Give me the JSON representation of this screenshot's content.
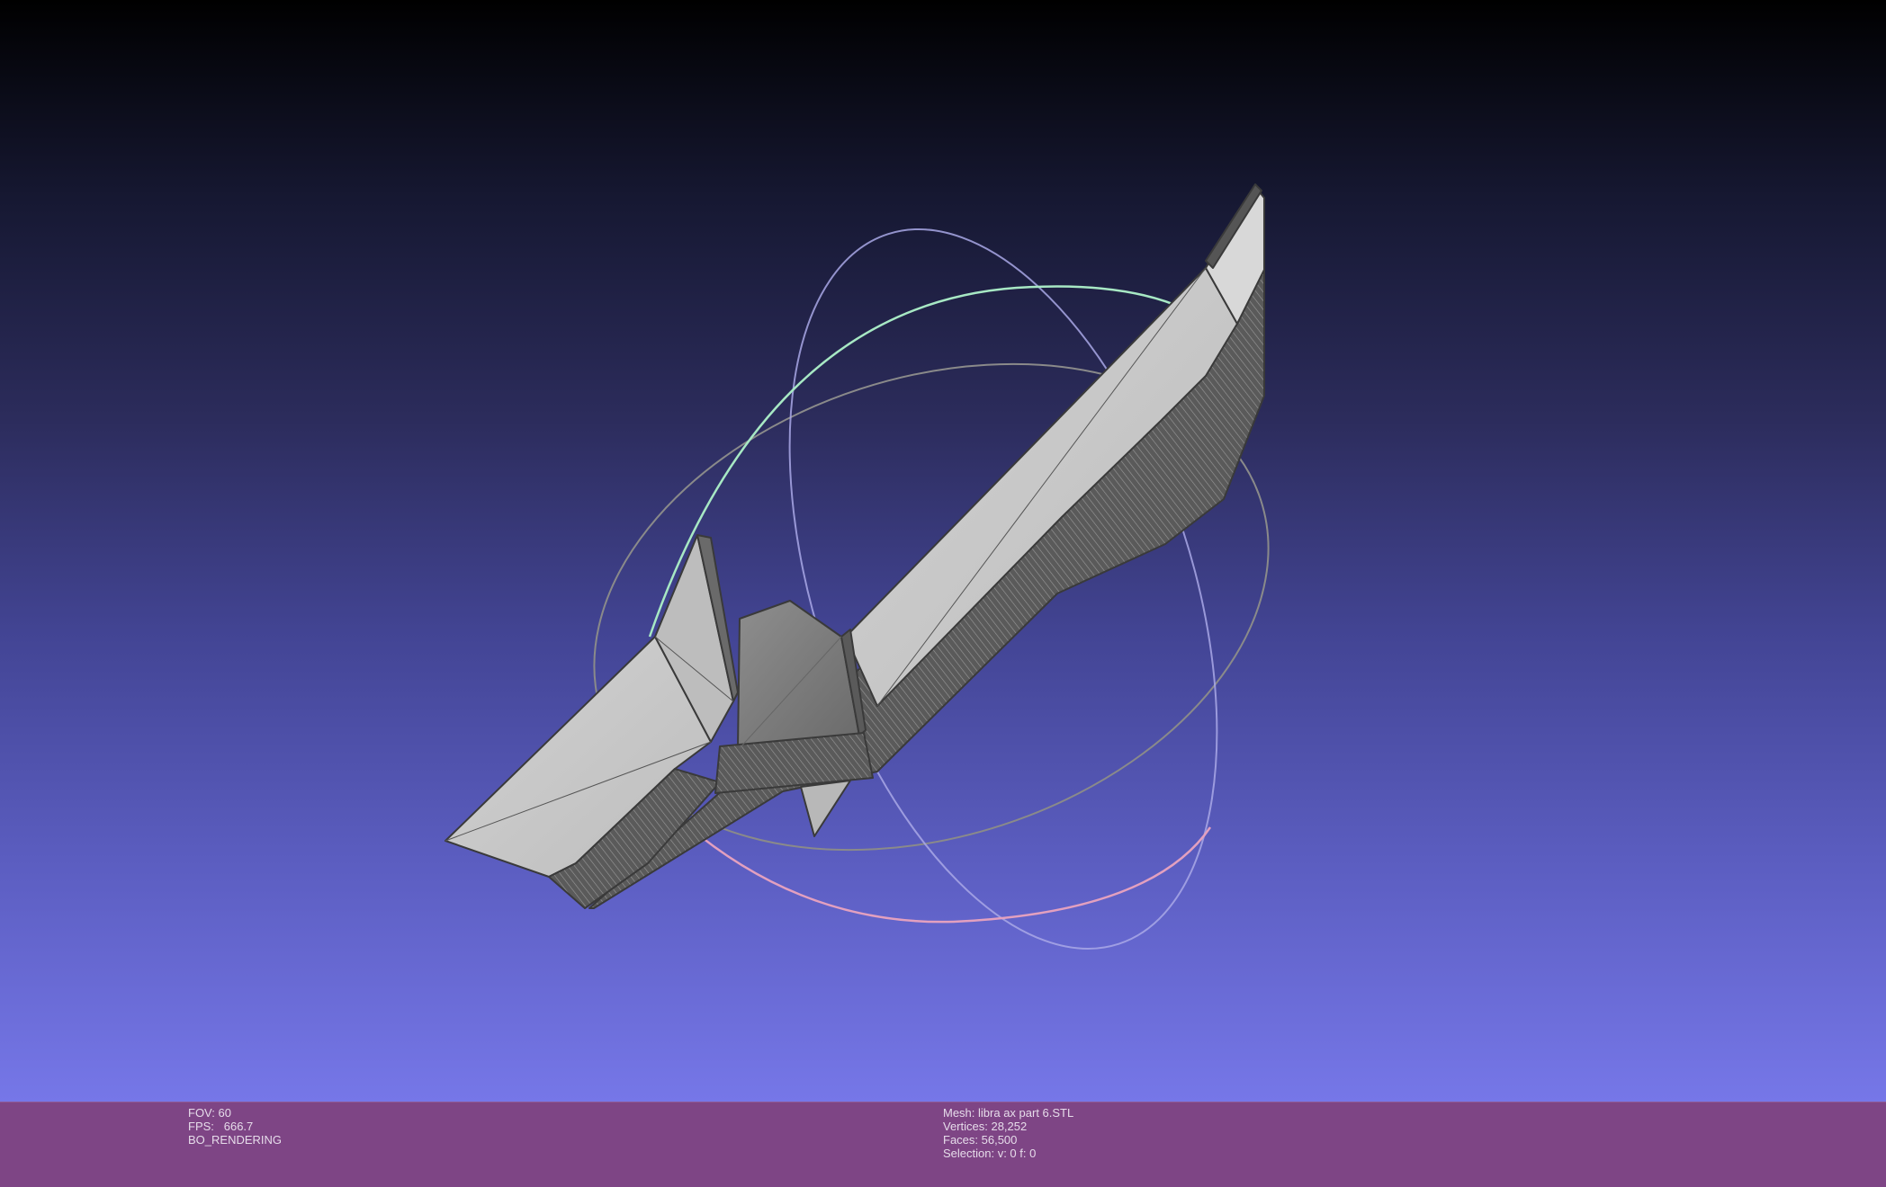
{
  "viewport": {
    "gradient_top": "#000000",
    "gradient_bottom": "#7677e8",
    "mesh_color": "#c8c8c8",
    "edge_color": "#3a3a3a",
    "trackball_colors": {
      "red_ring": "#e3a0bf",
      "green_ring": "#a7e8c4",
      "blue_ring": "#c9c8f2",
      "gray_ring": "#8a8a8a"
    }
  },
  "status_bar": {
    "background": "#7e4585",
    "left": {
      "fov": "FOV: 60",
      "fps": "FPS:   666.7",
      "render_mode": "BO_RENDERING"
    },
    "right": {
      "mesh": "Mesh: libra ax part 6.STL",
      "vertices": "Vertices: 28,252",
      "faces": "Faces: 56,500",
      "selection": "Selection: v: 0 f: 0"
    }
  }
}
